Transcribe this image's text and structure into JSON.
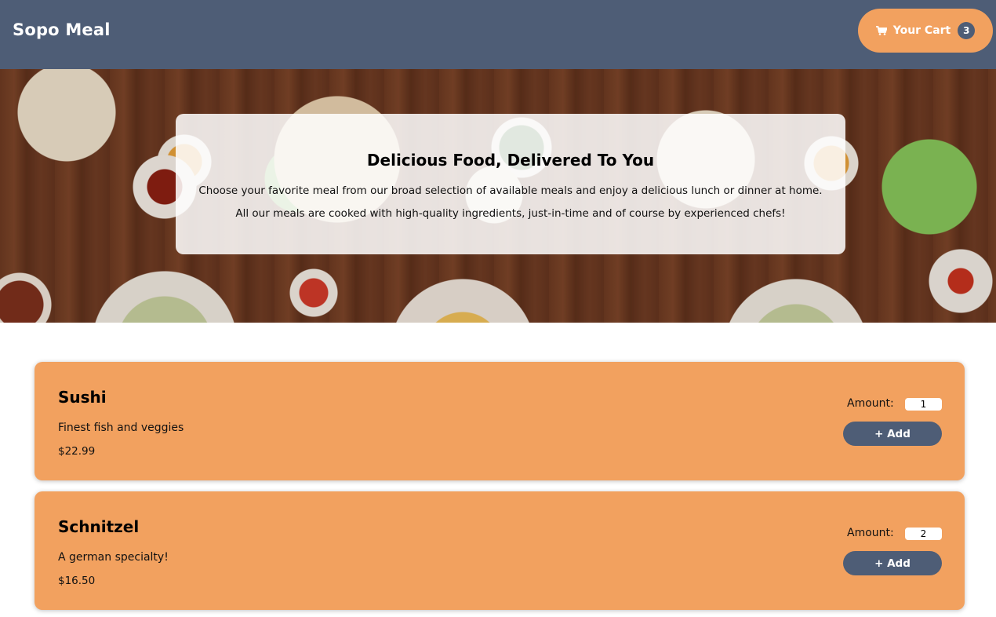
{
  "header": {
    "brand": "Sopo Meal",
    "cart": {
      "label": "Your Cart",
      "count": "3",
      "icon": "cart-icon"
    }
  },
  "hero": {
    "title": "Delicious Food, Delivered To You",
    "line1": "Choose your favorite meal from our broad selection of available meals and enjoy a delicious lunch or dinner at home.",
    "line2": "All our meals are cooked with high-quality ingredients, just-in-time and of course by experienced chefs!"
  },
  "meals": [
    {
      "name": "Sushi",
      "description": "Finest fish and veggies",
      "price": "$22.99",
      "amount_label": "Amount:",
      "amount": "1",
      "add_label": "+ Add"
    },
    {
      "name": "Schnitzel",
      "description": "A german specialty!",
      "price": "$16.50",
      "amount_label": "Amount:",
      "amount": "2",
      "add_label": "+ Add"
    }
  ],
  "colors": {
    "header_bg": "#4e5d76",
    "accent": "#f2a15f",
    "button_bg": "#4e5d76"
  }
}
